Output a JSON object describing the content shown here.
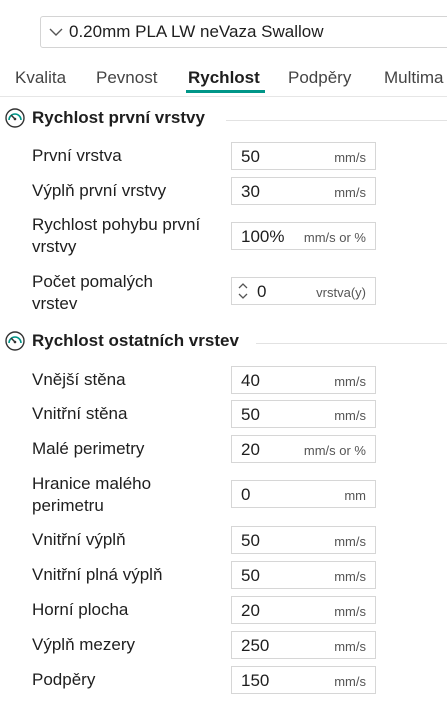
{
  "preset": {
    "name": "0.20mm PLA LW neVaza Swallow"
  },
  "tabs": [
    {
      "label": "Kvalita"
    },
    {
      "label": "Pevnost"
    },
    {
      "label": "Rychlost"
    },
    {
      "label": "Podpěry"
    },
    {
      "label": "Multima"
    }
  ],
  "active_tab": "Rychlost",
  "accent_color": "#009688",
  "sections": [
    {
      "title": "Rychlost první vrstvy",
      "icon": "speedometer-icon",
      "rows": [
        {
          "label": "První vrstva",
          "value": "50",
          "unit": "mm/s"
        },
        {
          "label": "Výplň první vrstvy",
          "value": "30",
          "unit": "mm/s"
        },
        {
          "label": "Rychlost pohybu první vrstvy",
          "value": "100%",
          "unit": "mm/s or %"
        },
        {
          "label": "Počet pomalých vrstev",
          "value": "0",
          "unit": "vrstva(y)"
        }
      ]
    },
    {
      "title": "Rychlost ostatních vrstev",
      "icon": "speedometer-icon",
      "rows": [
        {
          "label": "Vnější stěna",
          "value": "40",
          "unit": "mm/s"
        },
        {
          "label": "Vnitřní stěna",
          "value": "50",
          "unit": "mm/s"
        },
        {
          "label": "Malé perimetry",
          "value": "20",
          "unit": "mm/s or %"
        },
        {
          "label": "Hranice malého perimetru",
          "value": "0",
          "unit": "mm"
        },
        {
          "label": "Vnitřní výplň",
          "value": "50",
          "unit": "mm/s"
        },
        {
          "label": "Vnitřní plná výplň",
          "value": "50",
          "unit": "mm/s"
        },
        {
          "label": "Horní plocha",
          "value": "20",
          "unit": "mm/s"
        },
        {
          "label": "Výplň mezery",
          "value": "250",
          "unit": "mm/s"
        },
        {
          "label": "Podpěry",
          "value": "150",
          "unit": "mm/s"
        }
      ]
    }
  ]
}
